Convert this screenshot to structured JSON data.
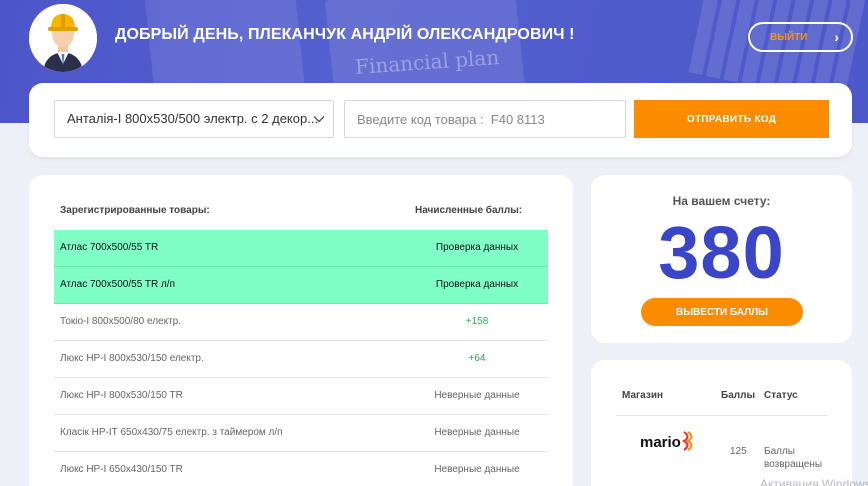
{
  "header": {
    "greeting": "ДОБРЫЙ ДЕНЬ, ПЛЕКАНЧУК АНДРІЙ ОЛЕКСАНДРОВИЧ !",
    "logout_label": "ВЫЙТИ",
    "background_text": "Financial plan"
  },
  "code_form": {
    "selected_product": "Анталія-І 800x530/500 электр. с 2 декор...",
    "code_placeholder": "Введите код товара :  F40 8113",
    "submit_label": "ОТПРАВИТЬ КОД"
  },
  "products": {
    "col_registered": "Зарегистрированные товары:",
    "col_points": "Начисленные баллы:",
    "rows": [
      {
        "name": "Атлас 700x500/55 TR",
        "status": "Проверка данных"
      },
      {
        "name": "Атлас 700x500/55 TR л/п",
        "status": "Проверка данных"
      },
      {
        "name": "Токіо-І 800x500/80 електр.",
        "status": "+158"
      },
      {
        "name": "Люкс НР-І 800x530/150 електр.",
        "status": "+64"
      },
      {
        "name": "Люкс НР-І 800x530/150 TR",
        "status": "Неверные данные"
      },
      {
        "name": "Класік НР-ІТ 650x430/75 електр. з таймером л/п",
        "status": "Неверные данные"
      },
      {
        "name": "Люкс НР-І 650x430/150 TR",
        "status": "Неверные данные"
      }
    ]
  },
  "balance": {
    "label": "На вашем счету:",
    "value": "380",
    "withdraw_label": "ВЫВЕСТИ БАЛЛЫ"
  },
  "stores": {
    "col_store": "Магазин",
    "col_points": "Баллы",
    "col_status": "Статус",
    "rows": [
      {
        "logo_text": "mario",
        "points": "125",
        "status": "Баллы возвращены"
      }
    ]
  },
  "watermark": "Активация Windows",
  "colors": {
    "accent_orange": "#fb8c00",
    "brand_blue": "#3b45c8",
    "pending_row": "#7ffec5",
    "positive_points": "#2eac54"
  }
}
